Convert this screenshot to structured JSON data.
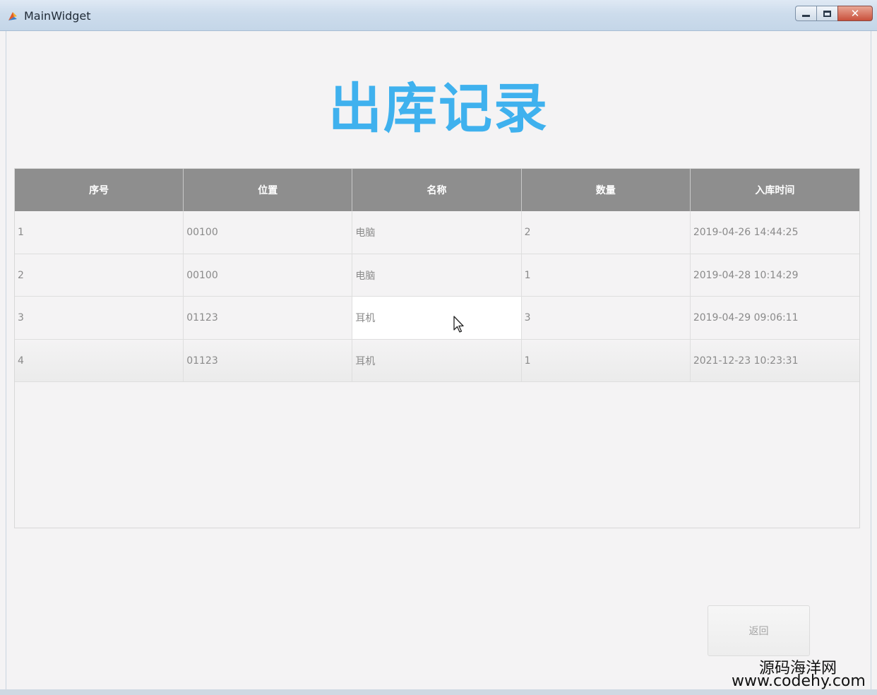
{
  "window": {
    "title": "MainWidget"
  },
  "page": {
    "title": "出库记录"
  },
  "table": {
    "columns": [
      "序号",
      "位置",
      "名称",
      "数量",
      "入库时间"
    ],
    "rows": [
      [
        "1",
        "00100",
        "电脑",
        "2",
        "2019-04-26 14:44:25"
      ],
      [
        "2",
        "00100",
        "电脑",
        "1",
        "2019-04-28 10:14:29"
      ],
      [
        "3",
        "01123",
        "耳机",
        "3",
        "2019-04-29 09:06:11"
      ],
      [
        "4",
        "01123",
        "耳机",
        "1",
        "2021-12-23 10:23:31"
      ]
    ]
  },
  "buttons": {
    "return_label": "返回"
  },
  "watermark": {
    "line1": "源码海洋网",
    "line2": "www.codehy.com"
  },
  "colors": {
    "title_accent": "#3fb1ee",
    "header_bg": "#8e8e8e"
  },
  "icons": {
    "app": "qt-app-icon",
    "cursor": "mouse-pointer-icon"
  }
}
